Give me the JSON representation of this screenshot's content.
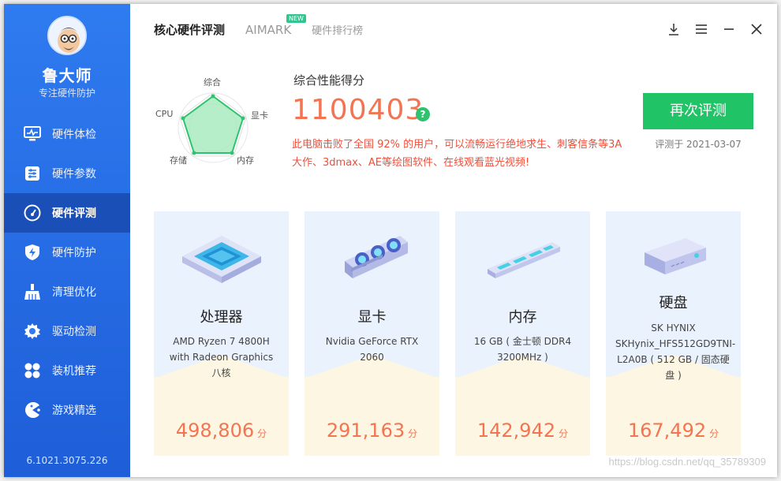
{
  "colors": {
    "sidebar": "#2f7bf0",
    "sidebar_active": "#1a4fb8",
    "accent_green": "#20c466",
    "score_orange": "#f47452",
    "desc_red": "#f04f3a",
    "card_blue": "#eaf2fd",
    "card_cream": "#fdf6e3"
  },
  "sidebar": {
    "brand": "鲁大师",
    "subtitle": "专注硬件防护",
    "version": "6.1021.3075.226",
    "items": [
      {
        "label": "硬件体检",
        "icon": "monitor-icon"
      },
      {
        "label": "硬件参数",
        "icon": "sliders-icon"
      },
      {
        "label": "硬件评测",
        "icon": "speedometer-icon"
      },
      {
        "label": "硬件防护",
        "icon": "shield-bolt-icon"
      },
      {
        "label": "清理优化",
        "icon": "broom-icon"
      },
      {
        "label": "驱动检测",
        "icon": "gear-icon"
      },
      {
        "label": "装机推荐",
        "icon": "grid-icon"
      },
      {
        "label": "游戏精选",
        "icon": "pacman-icon"
      }
    ],
    "active_index": 2
  },
  "header": {
    "tabs": [
      {
        "label": "核心硬件评测",
        "active": true
      },
      {
        "label": "AIMARK",
        "badge": "NEW"
      },
      {
        "label": "硬件排行榜"
      }
    ]
  },
  "radar": {
    "labels": {
      "top": "综合",
      "right": "显卡",
      "bottom_right": "内存",
      "bottom_left": "存储",
      "left": "CPU"
    }
  },
  "score": {
    "title": "综合性能得分",
    "value": "1100403",
    "help": "?",
    "description": "此电脑击败了全国 92% 的用户，可以流畅运行绝地求生、刺客信条等3A大作、3dmax、AE等绘图软件、在线观看蓝光视频!",
    "retest_label": "再次评测",
    "date": "评测于 2021-03-07"
  },
  "cards": [
    {
      "title": "处理器",
      "detail": "AMD Ryzen 7 4800H with Radeon Graphics 八核",
      "score": "498,806",
      "unit": "分",
      "icon": "cpu-chip-icon"
    },
    {
      "title": "显卡",
      "detail": "Nvidia GeForce RTX 2060",
      "score": "291,163",
      "unit": "分",
      "icon": "graphics-card-icon"
    },
    {
      "title": "内存",
      "detail": "16 GB ( 金士顿 DDR4 3200MHz )",
      "score": "142,942",
      "unit": "分",
      "icon": "memory-stick-icon"
    },
    {
      "title": "硬盘",
      "detail": "SK HYNIX SKHynix_HFS512GD9TNI-L2A0B ( 512 GB / 固态硬盘 )",
      "score": "167,492",
      "unit": "分",
      "icon": "hard-disk-icon"
    }
  ],
  "watermark": "https://blog.csdn.net/qq_35789309"
}
